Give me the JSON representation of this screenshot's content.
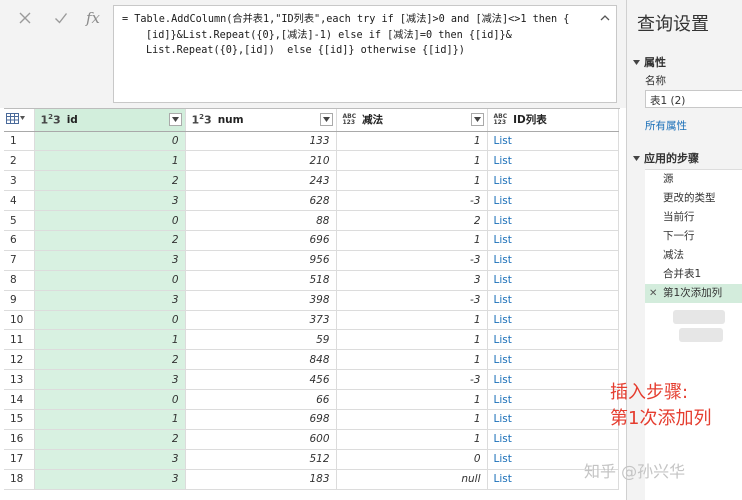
{
  "formula": {
    "line1": "= Table.AddColumn(合并表1,\"ID列表\",each try if [减法]>0 and [减法]<>1 then {",
    "line2": "[id]}&List.Repeat({0},[减法]-1) else if [减法]=0 then {[id]}&",
    "line3": "List.Repeat({0},[id])  else {[id]} otherwise {[id]})"
  },
  "table": {
    "columns": [
      {
        "type": "1²3",
        "name": "id"
      },
      {
        "type": "1²3",
        "name": "num"
      },
      {
        "type": "ABC123",
        "name": "减法"
      },
      {
        "type": "ABC123",
        "name": "ID列表"
      }
    ],
    "rows": [
      {
        "n": "1",
        "id": "0",
        "num": "133",
        "jian": "1",
        "list": "List"
      },
      {
        "n": "2",
        "id": "1",
        "num": "210",
        "jian": "1",
        "list": "List"
      },
      {
        "n": "3",
        "id": "2",
        "num": "243",
        "jian": "1",
        "list": "List"
      },
      {
        "n": "4",
        "id": "3",
        "num": "628",
        "jian": "-3",
        "list": "List"
      },
      {
        "n": "5",
        "id": "0",
        "num": "88",
        "jian": "2",
        "list": "List"
      },
      {
        "n": "6",
        "id": "2",
        "num": "696",
        "jian": "1",
        "list": "List"
      },
      {
        "n": "7",
        "id": "3",
        "num": "956",
        "jian": "-3",
        "list": "List"
      },
      {
        "n": "8",
        "id": "0",
        "num": "518",
        "jian": "3",
        "list": "List"
      },
      {
        "n": "9",
        "id": "3",
        "num": "398",
        "jian": "-3",
        "list": "List"
      },
      {
        "n": "10",
        "id": "0",
        "num": "373",
        "jian": "1",
        "list": "List"
      },
      {
        "n": "11",
        "id": "1",
        "num": "59",
        "jian": "1",
        "list": "List"
      },
      {
        "n": "12",
        "id": "2",
        "num": "848",
        "jian": "1",
        "list": "List"
      },
      {
        "n": "13",
        "id": "3",
        "num": "456",
        "jian": "-3",
        "list": "List"
      },
      {
        "n": "14",
        "id": "0",
        "num": "66",
        "jian": "1",
        "list": "List"
      },
      {
        "n": "15",
        "id": "1",
        "num": "698",
        "jian": "1",
        "list": "List"
      },
      {
        "n": "16",
        "id": "2",
        "num": "600",
        "jian": "1",
        "list": "List"
      },
      {
        "n": "17",
        "id": "3",
        "num": "512",
        "jian": "0",
        "list": "List"
      },
      {
        "n": "18",
        "id": "3",
        "num": "183",
        "jian": "null",
        "list": "List"
      }
    ]
  },
  "pane": {
    "title": "查询设置",
    "properties_heading": "属性",
    "name_label": "名称",
    "name_value": "表1 (2)",
    "all_properties": "所有属性",
    "steps_heading": "应用的步骤",
    "steps": [
      "源",
      "更改的类型",
      "当前行",
      "下一行",
      "减法",
      "合并表1",
      "第1次添加列"
    ]
  },
  "annotation": {
    "line1": "插入步骤:",
    "line2": "第1次添加列"
  },
  "watermark": "知乎 @孙兴华",
  "colors": {
    "id_column_bg": "#d8f1e1",
    "list_link": "#1a6fb8",
    "annotation": "#e53d2f"
  }
}
